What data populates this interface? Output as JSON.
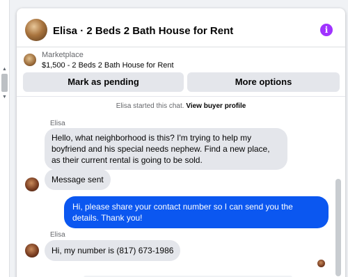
{
  "header": {
    "title": "Elisa · 2 Beds 2 Bath House for Rent",
    "info_icon": "i"
  },
  "listing": {
    "label": "Marketplace",
    "title": "$1,500 - 2 Beds 2 Bath House for Rent"
  },
  "actions": {
    "mark_pending": "Mark as pending",
    "more_options": "More options"
  },
  "system_message": {
    "text": "Elisa started this chat.",
    "link": "View buyer profile"
  },
  "messages": [
    {
      "sender": "Elisa",
      "direction": "incoming",
      "text": "Hello, what neighborhood is this? I'm trying to help my boyfriend and his special needs nephew. Find a new place, as their current rental is going to be sold."
    },
    {
      "direction": "incoming",
      "text": "Message sent"
    },
    {
      "direction": "outgoing",
      "text": "Hi, please share your contact number so I can send you the details. Thank you!"
    },
    {
      "sender": "Elisa",
      "direction": "incoming",
      "text": "Hi, my number is (817) 673-1986"
    }
  ],
  "colors": {
    "outgoing_bubble": "#0b57f0",
    "incoming_bubble": "#e4e6eb",
    "info_icon": "#a033ff",
    "button_bg": "#e4e6eb"
  },
  "icons": [
    "info-icon",
    "scroll-up-arrow-icon",
    "scroll-down-arrow-icon"
  ]
}
